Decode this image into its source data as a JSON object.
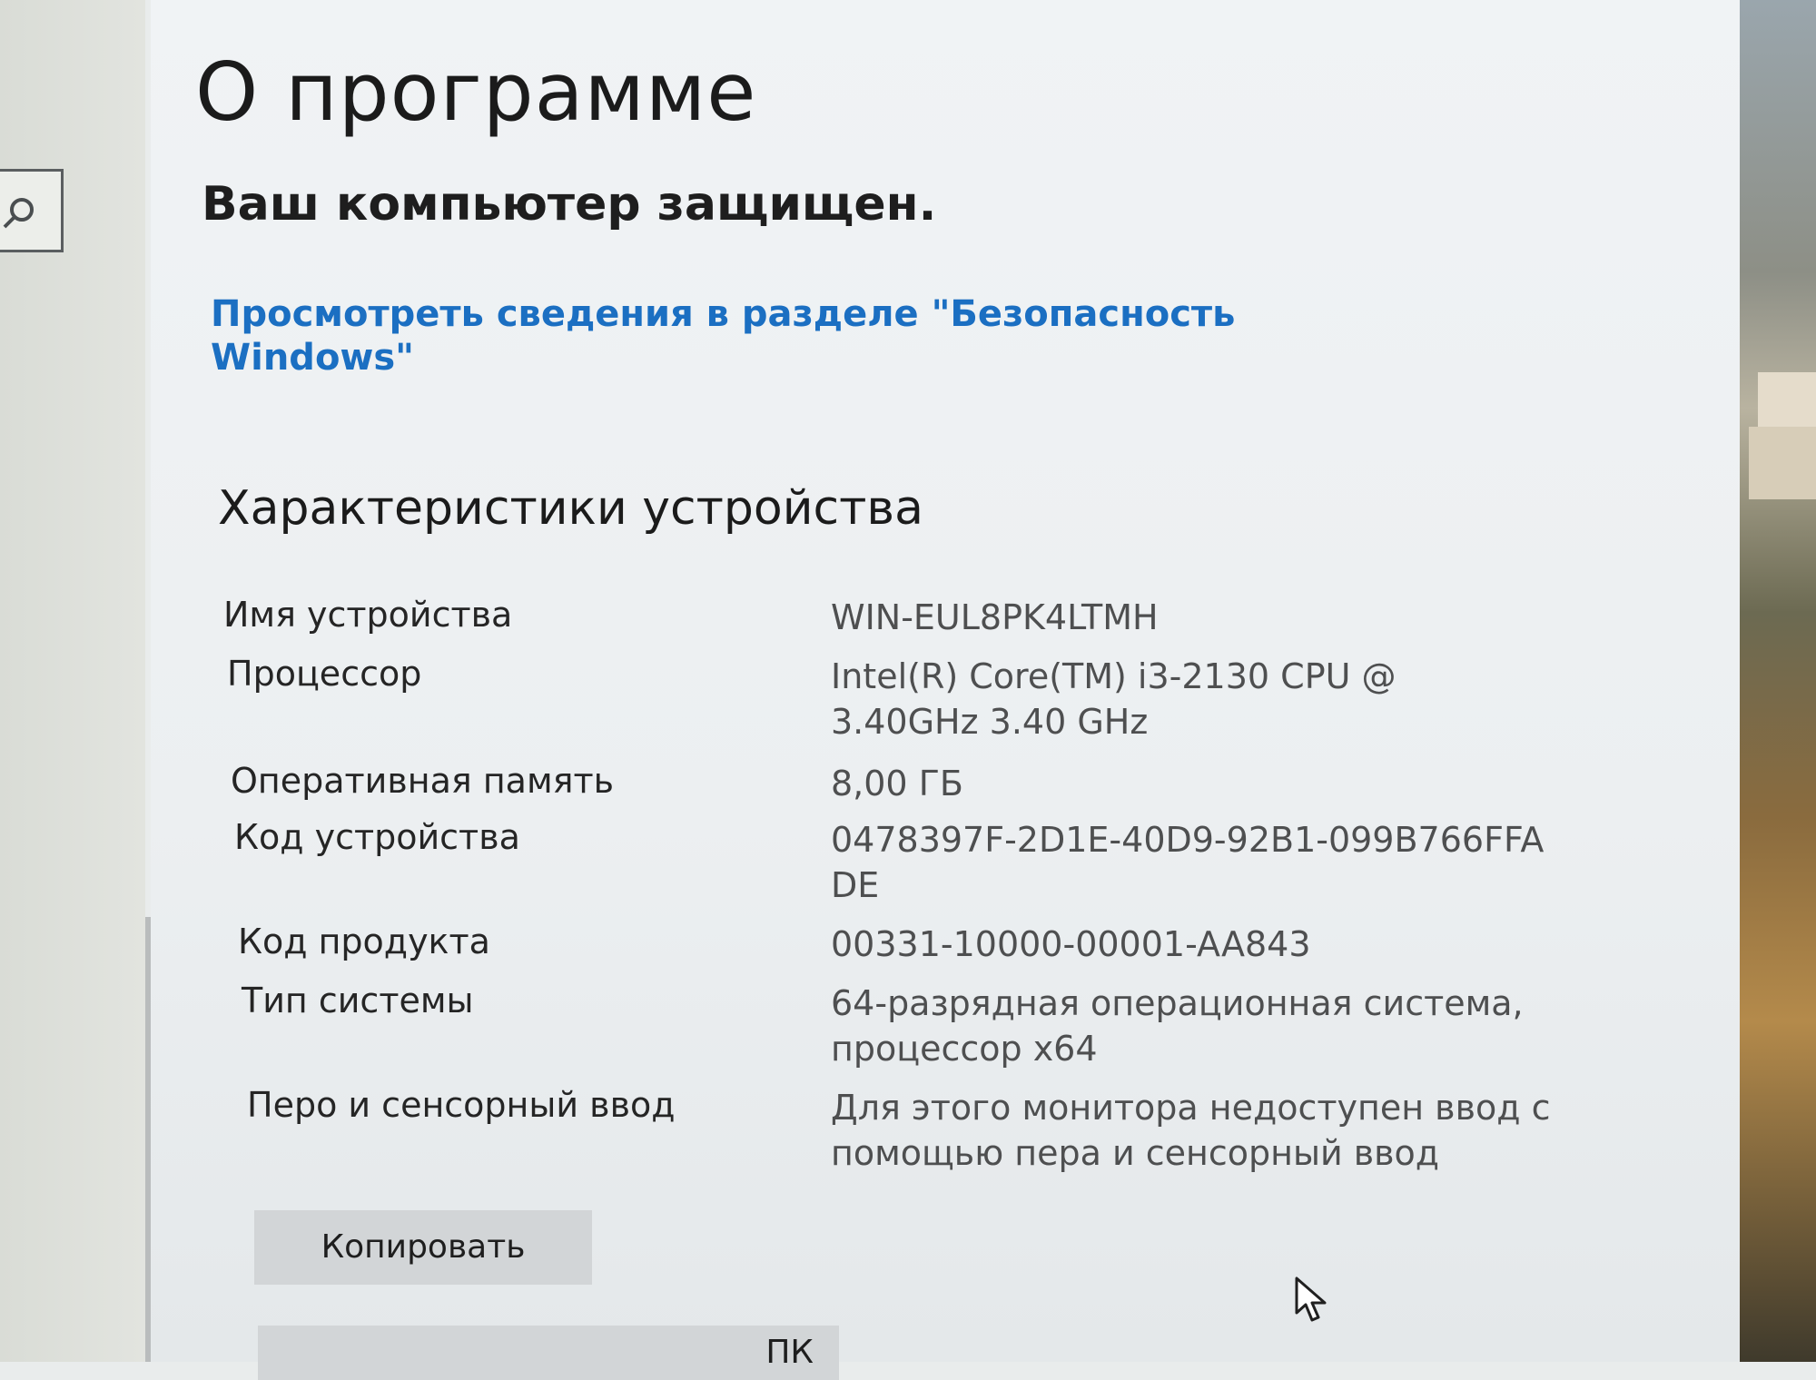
{
  "page": {
    "title": "О программе",
    "security_status": "Ваш компьютер защищен.",
    "security_link": "Просмотреть сведения в разделе \"Безопасность Windows\""
  },
  "device_specs": {
    "section_title": "Характеристики устройства",
    "rows": [
      {
        "label": "Имя устройства",
        "value_lines": [
          "WIN-EUL8PK4LTMH"
        ]
      },
      {
        "label": "Процессор",
        "value_lines": [
          "Intel(R) Core(TM) i3-2130 CPU @",
          "3.40GHz   3.40 GHz"
        ]
      },
      {
        "label": "Оперативная память",
        "value_lines": [
          "8,00 ГБ"
        ]
      },
      {
        "label": "Код устройства",
        "value_lines": [
          "0478397F-2D1E-40D9-92B1-099B766FFA",
          "DE"
        ]
      },
      {
        "label": "Код продукта",
        "value_lines": [
          "00331-10000-00001-AA843"
        ]
      },
      {
        "label": "Тип системы",
        "value_lines": [
          "64-разрядная операционная система,",
          "процессор x64"
        ]
      },
      {
        "label": "Перо и сенсорный ввод",
        "value_lines": [
          "Для этого монитора недоступен ввод с",
          "помощью пера и сенсорный ввод"
        ]
      }
    ]
  },
  "buttons": {
    "copy_label": "Копировать",
    "rename_label_partial": "ПК"
  },
  "icons": {
    "search": "search-icon",
    "cursor": "mouse-cursor-icon"
  },
  "colors": {
    "link": "#1b6fc2",
    "label_text": "#252525",
    "value_text": "#4e4f50",
    "button_bg": "#d2d5d7"
  }
}
